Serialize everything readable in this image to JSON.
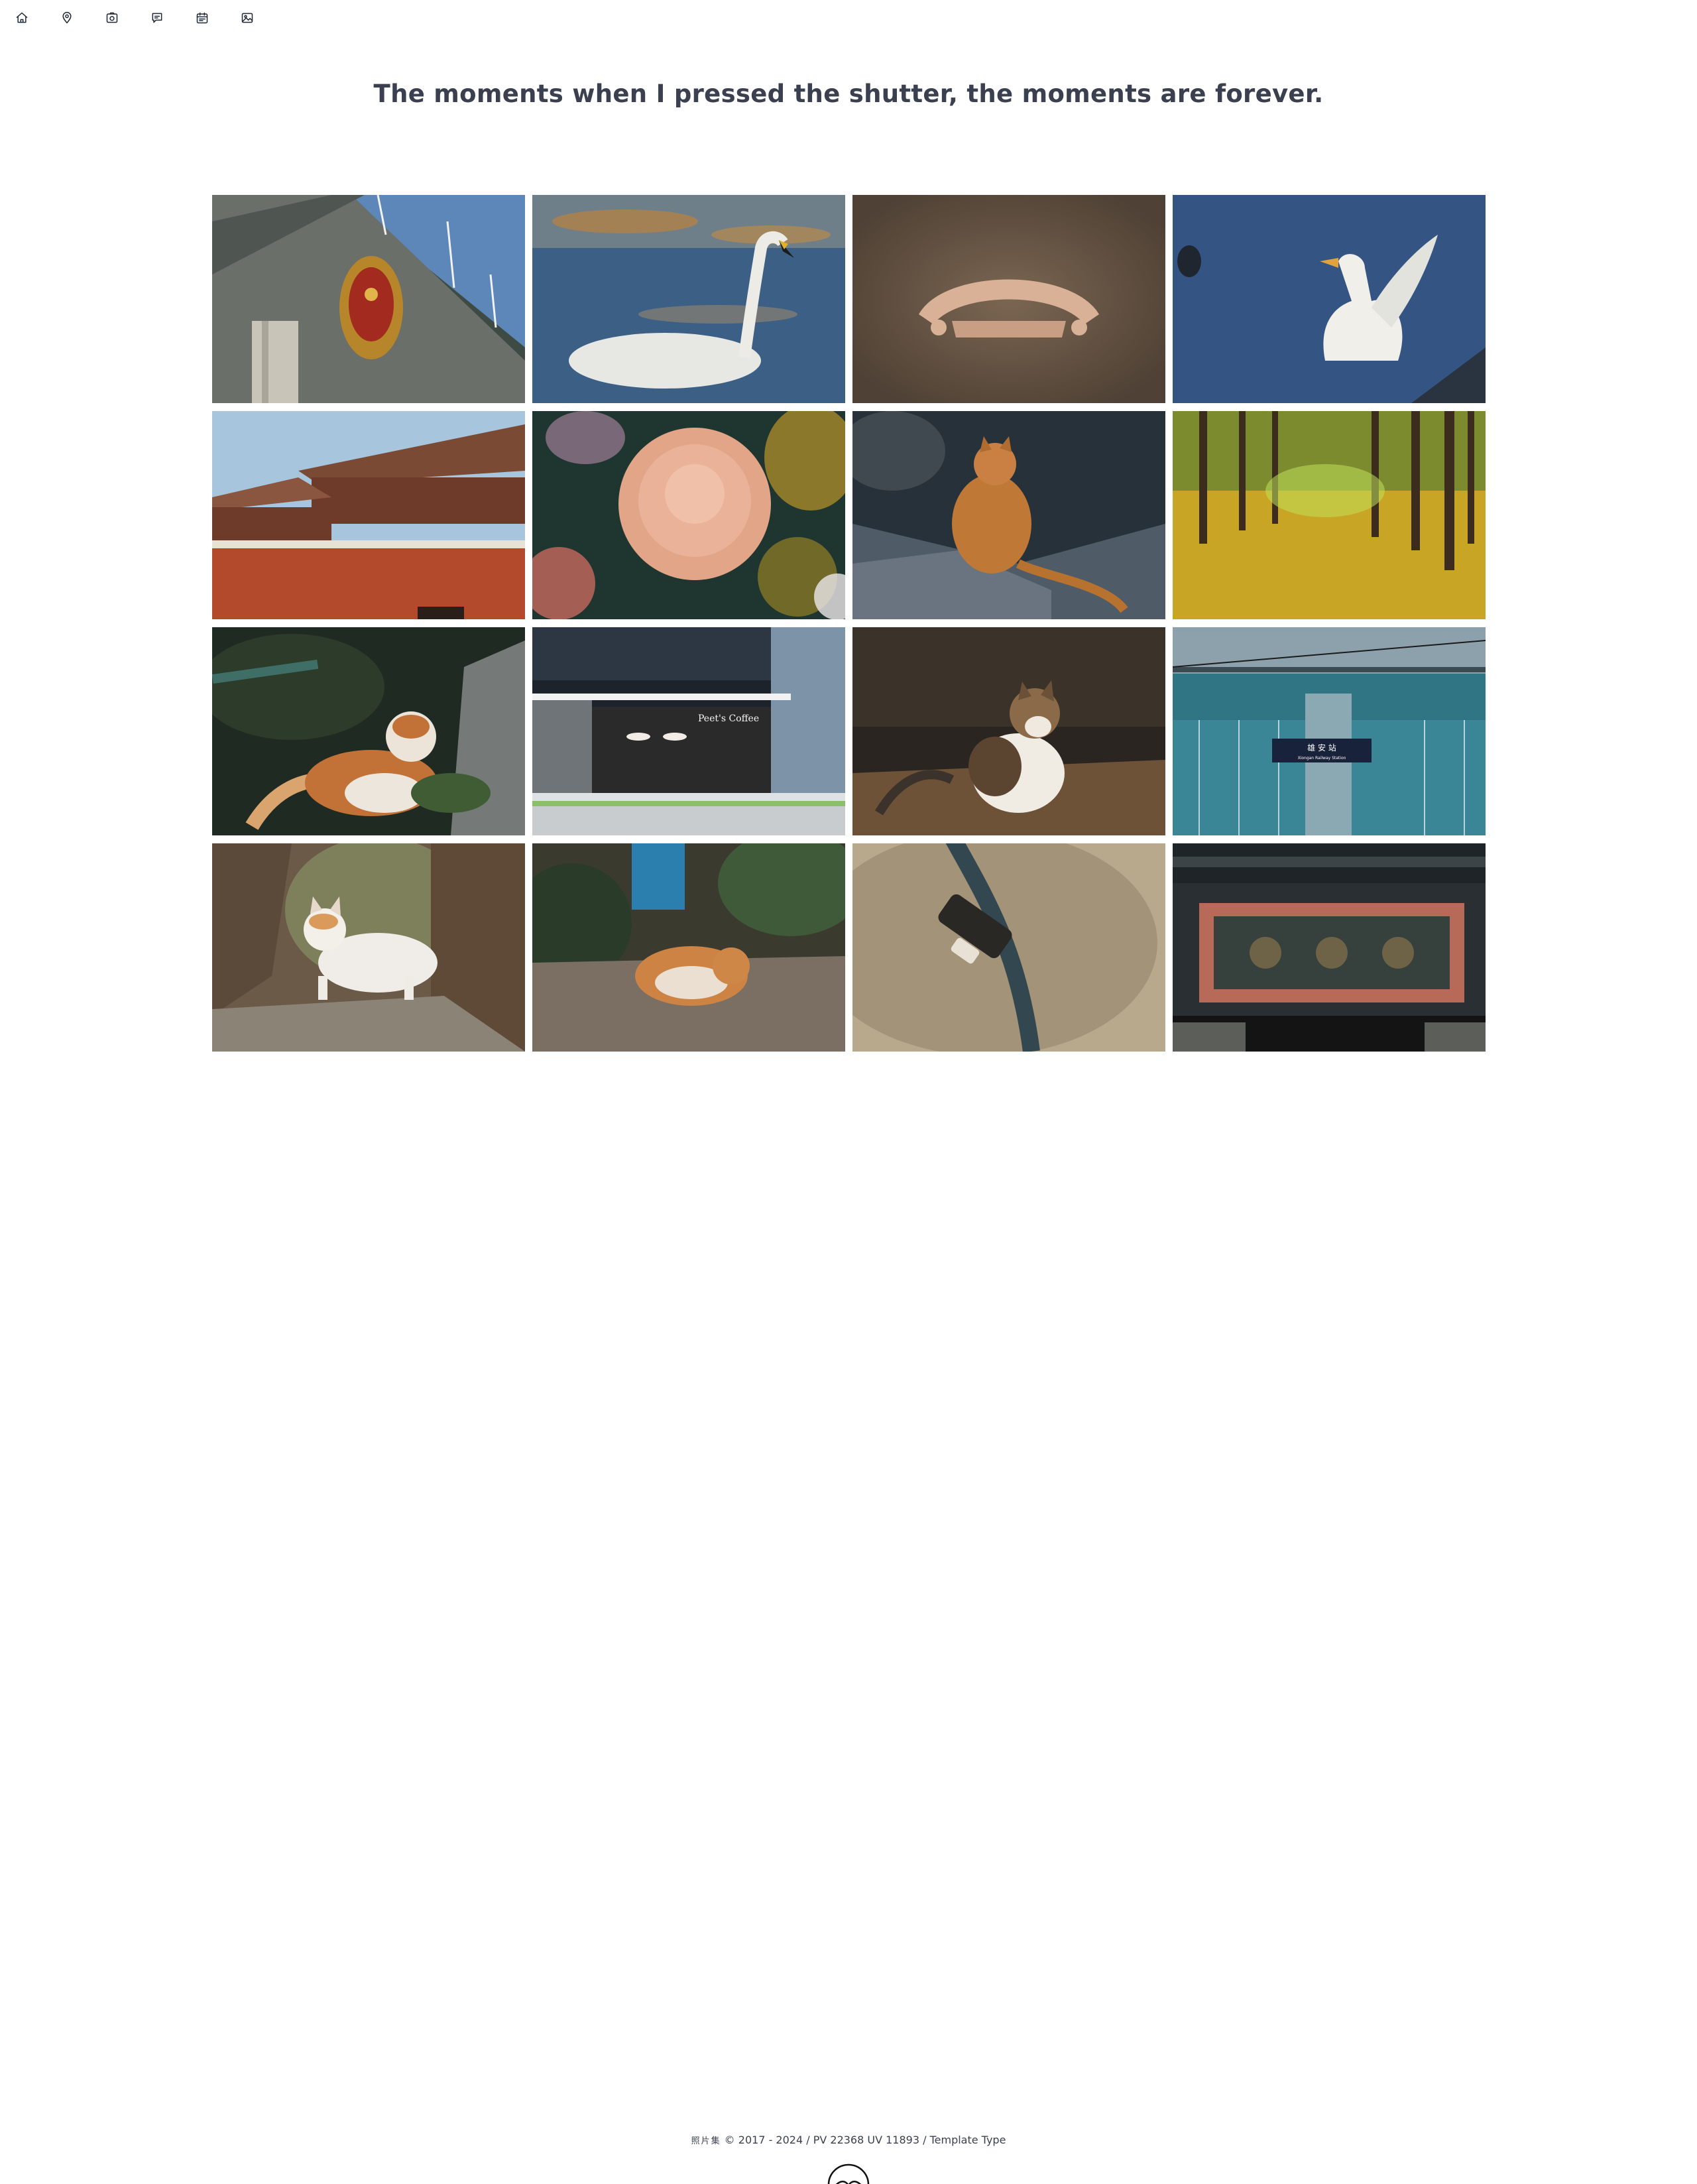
{
  "nav": {
    "icons": [
      "home-icon",
      "location-pin-icon",
      "camera-icon",
      "chat-bubble-icon",
      "calendar-icon",
      "image-icon"
    ]
  },
  "headline": "The moments when I pressed the shutter, the moments are forever.",
  "gallery": {
    "photos": [
      {
        "subject": "national-emblem-on-building"
      },
      {
        "subject": "swan-on-water"
      },
      {
        "subject": "carved-ornament"
      },
      {
        "subject": "white-duck-flapping"
      },
      {
        "subject": "red-palace-gate"
      },
      {
        "subject": "chrysanthemum-flower"
      },
      {
        "subject": "orange-cat-on-rock"
      },
      {
        "subject": "ginkgo-forest"
      },
      {
        "subject": "orange-white-cat-in-grass"
      },
      {
        "subject": "peets-coffee-storefront",
        "sign_text": "Peet's Coffee"
      },
      {
        "subject": "calico-cat-on-ground"
      },
      {
        "subject": "railway-station-sign",
        "sign_text": "雄 安 站",
        "sign_subtext": "Xiongan Railway Station"
      },
      {
        "subject": "white-cat-between-rocks"
      },
      {
        "subject": "sleeping-ginger-cat"
      },
      {
        "subject": "bottle-in-sand"
      },
      {
        "subject": "carved-wooden-plaque"
      }
    ]
  },
  "footer": {
    "brand": "照片集",
    "text": "© 2017 - 2024 / PV 22368 UV 11893 / ",
    "link": "Template Type"
  },
  "colors": {
    "text": "#3a404f",
    "background": "#ffffff"
  }
}
